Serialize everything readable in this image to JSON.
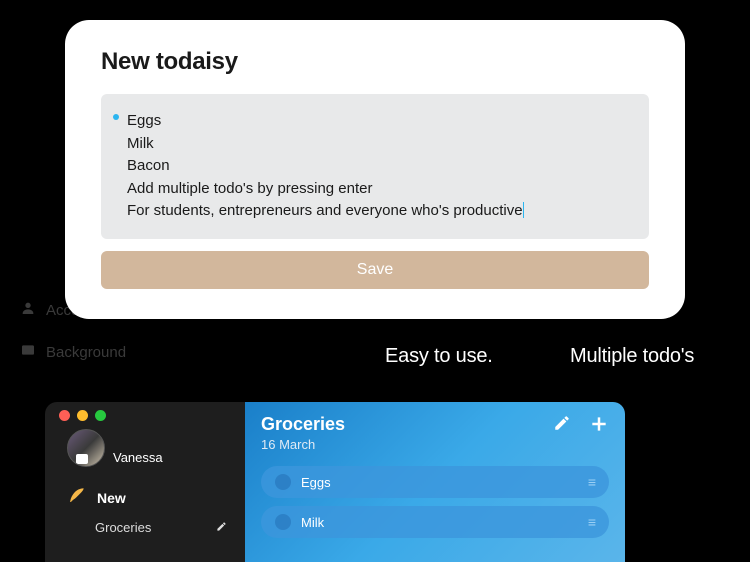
{
  "modal": {
    "title": "New todaisy",
    "lines": [
      "Eggs",
      "Milk",
      "Bacon",
      "Add multiple todo's by pressing enter",
      "For students, entrepreneurs and everyone who's productive"
    ],
    "save_label": "Save"
  },
  "bg_sidebar": {
    "account": "Account",
    "background": "Background"
  },
  "features": {
    "easy": "Easy to use.",
    "multiple": "Multiple todo's"
  },
  "app": {
    "profile_name": "Vanessa",
    "new_label": "New",
    "sidebar_list": "Groceries",
    "main_title": "Groceries",
    "main_date": "16 March",
    "items": [
      "Eggs",
      "Milk"
    ]
  }
}
